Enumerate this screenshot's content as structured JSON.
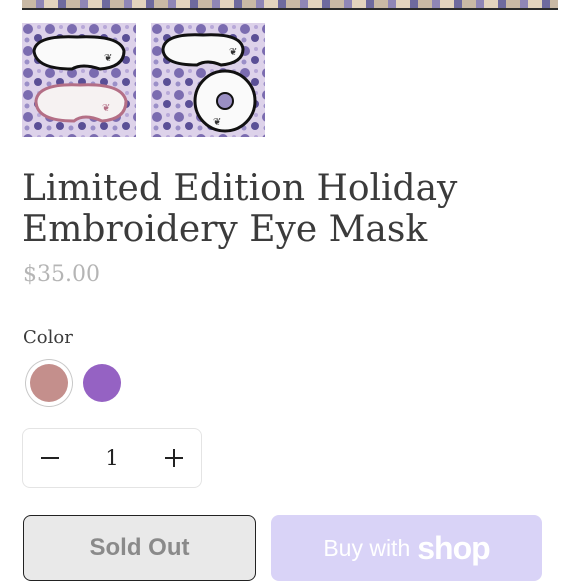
{
  "gallery": {
    "thumbnails": [
      {
        "icon": "eye-mask-pair-photo"
      },
      {
        "icon": "eye-mask-scrunchie-photo"
      }
    ]
  },
  "product": {
    "title_line1": "Limited Edition Holiday",
    "title_line2": "Embroidery Eye Mask",
    "price": "$35.00"
  },
  "options": {
    "color_label": "Color",
    "swatches": [
      {
        "color": "#c48f8c",
        "selected": true
      },
      {
        "color": "#9562c3",
        "selected": false
      }
    ]
  },
  "quantity": {
    "value": "1",
    "decrement_icon": "minus-icon",
    "increment_icon": "plus-icon"
  },
  "actions": {
    "sold_out_label": "Sold Out",
    "buy_with_label": "Buy with",
    "shop_brand": "shop"
  },
  "colors": {
    "text": "#3b3b3b",
    "price": "#b5b5b5",
    "shop_button": "#d9d3f7"
  }
}
